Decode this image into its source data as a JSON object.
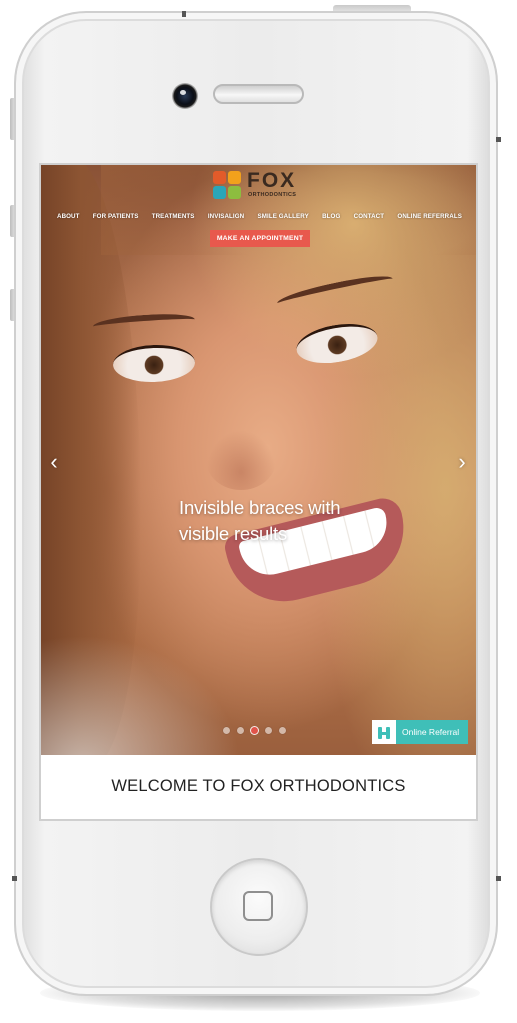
{
  "site": {
    "logo": {
      "name": "FOX",
      "tagline": "ORTHODONTICS",
      "colors": [
        "#e25b2a",
        "#f2a11c",
        "#2aa6b8",
        "#8dbd3f"
      ]
    },
    "nav": [
      {
        "label": "ABOUT"
      },
      {
        "label": "FOR PATIENTS"
      },
      {
        "label": "TREATMENTS"
      },
      {
        "label": "INVISALIGN"
      },
      {
        "label": "SMILE GALLERY"
      },
      {
        "label": "BLOG"
      },
      {
        "label": "CONTACT"
      },
      {
        "label": "ONLINE REFERRALS"
      }
    ],
    "cta_label": "MAKE AN APPOINTMENT",
    "cta_color": "#e8594d"
  },
  "hero": {
    "caption_line1": "Invisible braces with",
    "caption_line2": "visible results",
    "prev_icon": "chevron-left-icon",
    "next_icon": "chevron-right-icon",
    "prev_glyph": "‹",
    "next_glyph": "›",
    "slides_total": 5,
    "active_slide": 3
  },
  "referral": {
    "label": "Online Referral",
    "icon": "referral-icon",
    "color": "#3fbfb8"
  },
  "welcome_heading": "WELCOME TO FOX ORTHODONTICS"
}
